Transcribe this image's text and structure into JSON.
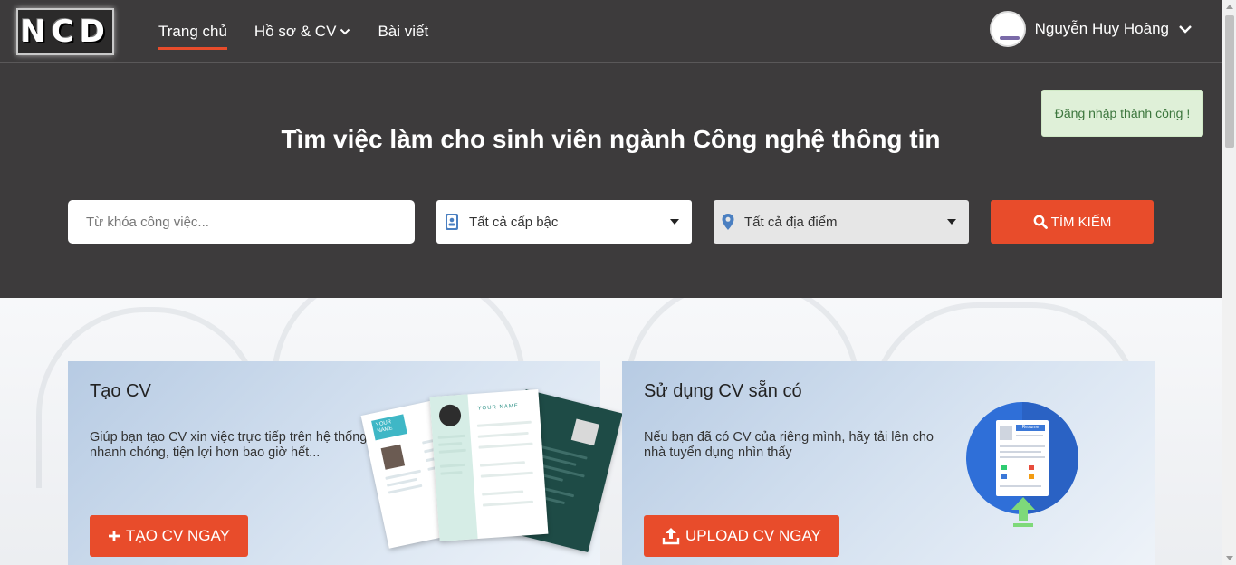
{
  "brand": {
    "logo_text": "NCD"
  },
  "nav": {
    "items": [
      {
        "label": "Trang chủ",
        "active": true
      },
      {
        "label": "Hồ sơ & CV",
        "has_dropdown": true
      },
      {
        "label": "Bài viết"
      }
    ]
  },
  "user": {
    "name": "Nguyễn Huy Hoàng"
  },
  "toast": {
    "message": "Đăng nhập thành công !"
  },
  "hero": {
    "title": "Tìm việc làm cho sinh viên ngành Công nghệ thông tin",
    "search": {
      "keyword_placeholder": "Từ khóa công việc...",
      "level_selected": "Tất cả cấp bậc",
      "location_selected": "Tất cả địa điểm",
      "button_label": "TÌM KIẾM"
    }
  },
  "cards": {
    "create": {
      "title": "Tạo CV",
      "description": "Giúp bạn tạo CV xin việc trực tiếp trên hệ thống nhanh chóng, tiện lợi hơn bao giờ hết...",
      "button_label": "TẠO CV NGAY",
      "thumb_text_a": "YOUR NAME",
      "thumb_text_b": "YOUR NAME"
    },
    "upload": {
      "title": "Sử dụng CV sẵn có",
      "description": "Nếu bạn đã có CV của riêng mình, hãy tải lên cho nhà tuyển dụng nhìn thấy",
      "button_label": "UPLOAD CV NGAY",
      "doc_header": "Resume"
    }
  },
  "colors": {
    "accent": "#e84c2b",
    "header_bg": "#3d3b3c",
    "toast_bg": "#dff0d8"
  }
}
